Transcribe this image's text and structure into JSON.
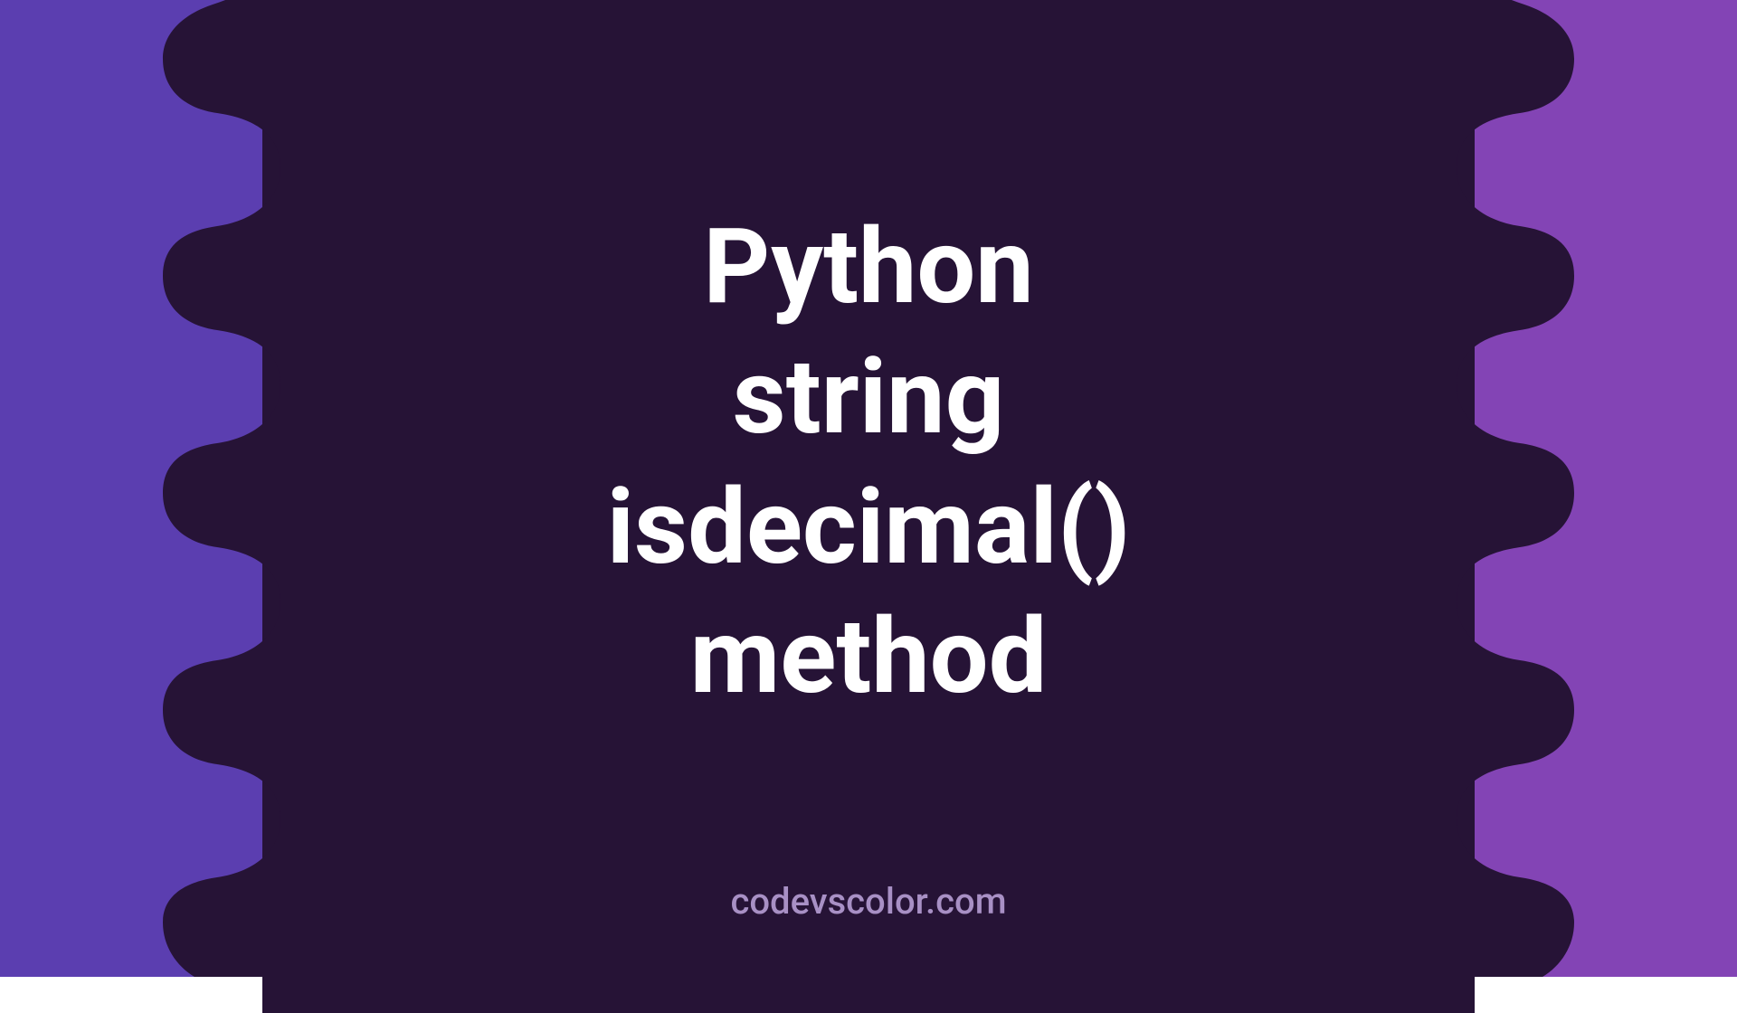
{
  "title": {
    "line1": "Python",
    "line2": "string",
    "line3": "isdecimal()",
    "line4": "method"
  },
  "footer": "codevscolor.com",
  "colors": {
    "bgLeft": "#5b3eb0",
    "bgRight": "#8344b5",
    "blob": "#261336",
    "text": "#ffffff",
    "footer": "#a890c5"
  }
}
